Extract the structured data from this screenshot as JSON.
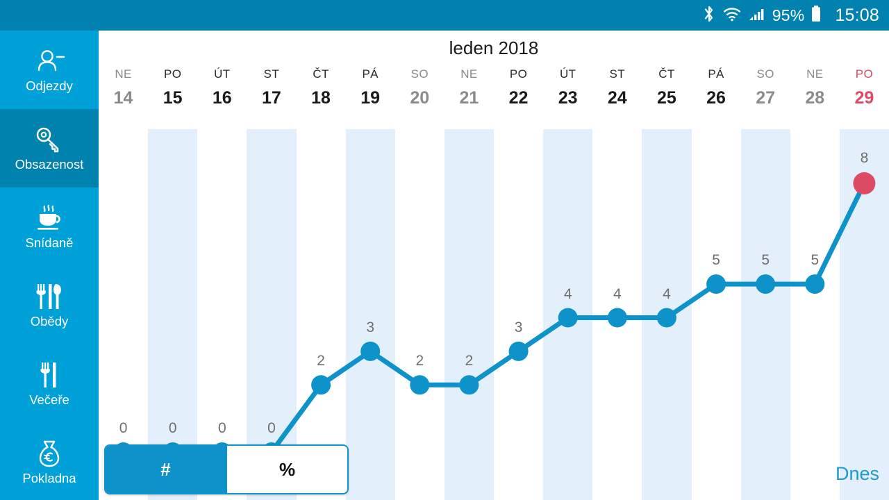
{
  "statusbar": {
    "icons": [
      "bluetooth-icon",
      "wifi-icon",
      "cellular-signal-icon",
      "battery-icon"
    ],
    "battery_percent": "95%",
    "clock": "15:08"
  },
  "sidebar": {
    "items": [
      {
        "label": "Odjezdy",
        "icon": "person-minus-icon",
        "active": false
      },
      {
        "label": "Obsazenost",
        "icon": "key-icon",
        "active": true
      },
      {
        "label": "Snídaně",
        "icon": "coffee-cup-icon",
        "active": false
      },
      {
        "label": "Obědy",
        "icon": "cutlery-full-icon",
        "active": false
      },
      {
        "label": "Večeře",
        "icon": "cutlery-icon",
        "active": false
      },
      {
        "label": "Pokladna",
        "icon": "money-bag-euro-icon",
        "active": false
      }
    ]
  },
  "header": {
    "title": "leden 2018"
  },
  "footer": {
    "toggle": [
      {
        "label": "#",
        "selected": true
      },
      {
        "label": "%",
        "selected": false
      }
    ],
    "today_link": "Dnes"
  },
  "colors": {
    "brand_blue": "#00a0d8",
    "status_blue": "#0081b0",
    "sidebar_active": "#0082ae",
    "line_blue": "#0d93c9",
    "today_red": "#dc4a63",
    "stripe": "#e3effa",
    "label_gray": "#6e6e6e"
  },
  "chart_data": {
    "type": "line",
    "title": "leden 2018",
    "xlabel": "",
    "ylabel": "",
    "ylim": [
      0,
      8
    ],
    "grid": false,
    "legend": null,
    "categories": [
      "14",
      "15",
      "16",
      "17",
      "18",
      "19",
      "20",
      "21",
      "22",
      "23",
      "24",
      "25",
      "26",
      "27",
      "28",
      "29"
    ],
    "weekdays": [
      "NE",
      "PO",
      "ÚT",
      "ST",
      "ČT",
      "PÁ",
      "SO",
      "NE",
      "PO",
      "ÚT",
      "ST",
      "ČT",
      "PÁ",
      "SO",
      "NE",
      "PO"
    ],
    "weekend": [
      true,
      false,
      false,
      false,
      false,
      false,
      true,
      true,
      false,
      false,
      false,
      false,
      false,
      true,
      true,
      false
    ],
    "today_index": 15,
    "values": [
      0,
      0,
      0,
      0,
      2,
      3,
      2,
      2,
      3,
      4,
      4,
      4,
      5,
      5,
      5,
      8
    ],
    "point_labels": [
      "0",
      "0",
      "0",
      "0",
      "2",
      "3",
      "2",
      "2",
      "3",
      "4",
      "4",
      "4",
      "5",
      "5",
      "5",
      "8"
    ],
    "stripe_columns": [
      1,
      3,
      5,
      7,
      9,
      11,
      13,
      15
    ]
  }
}
